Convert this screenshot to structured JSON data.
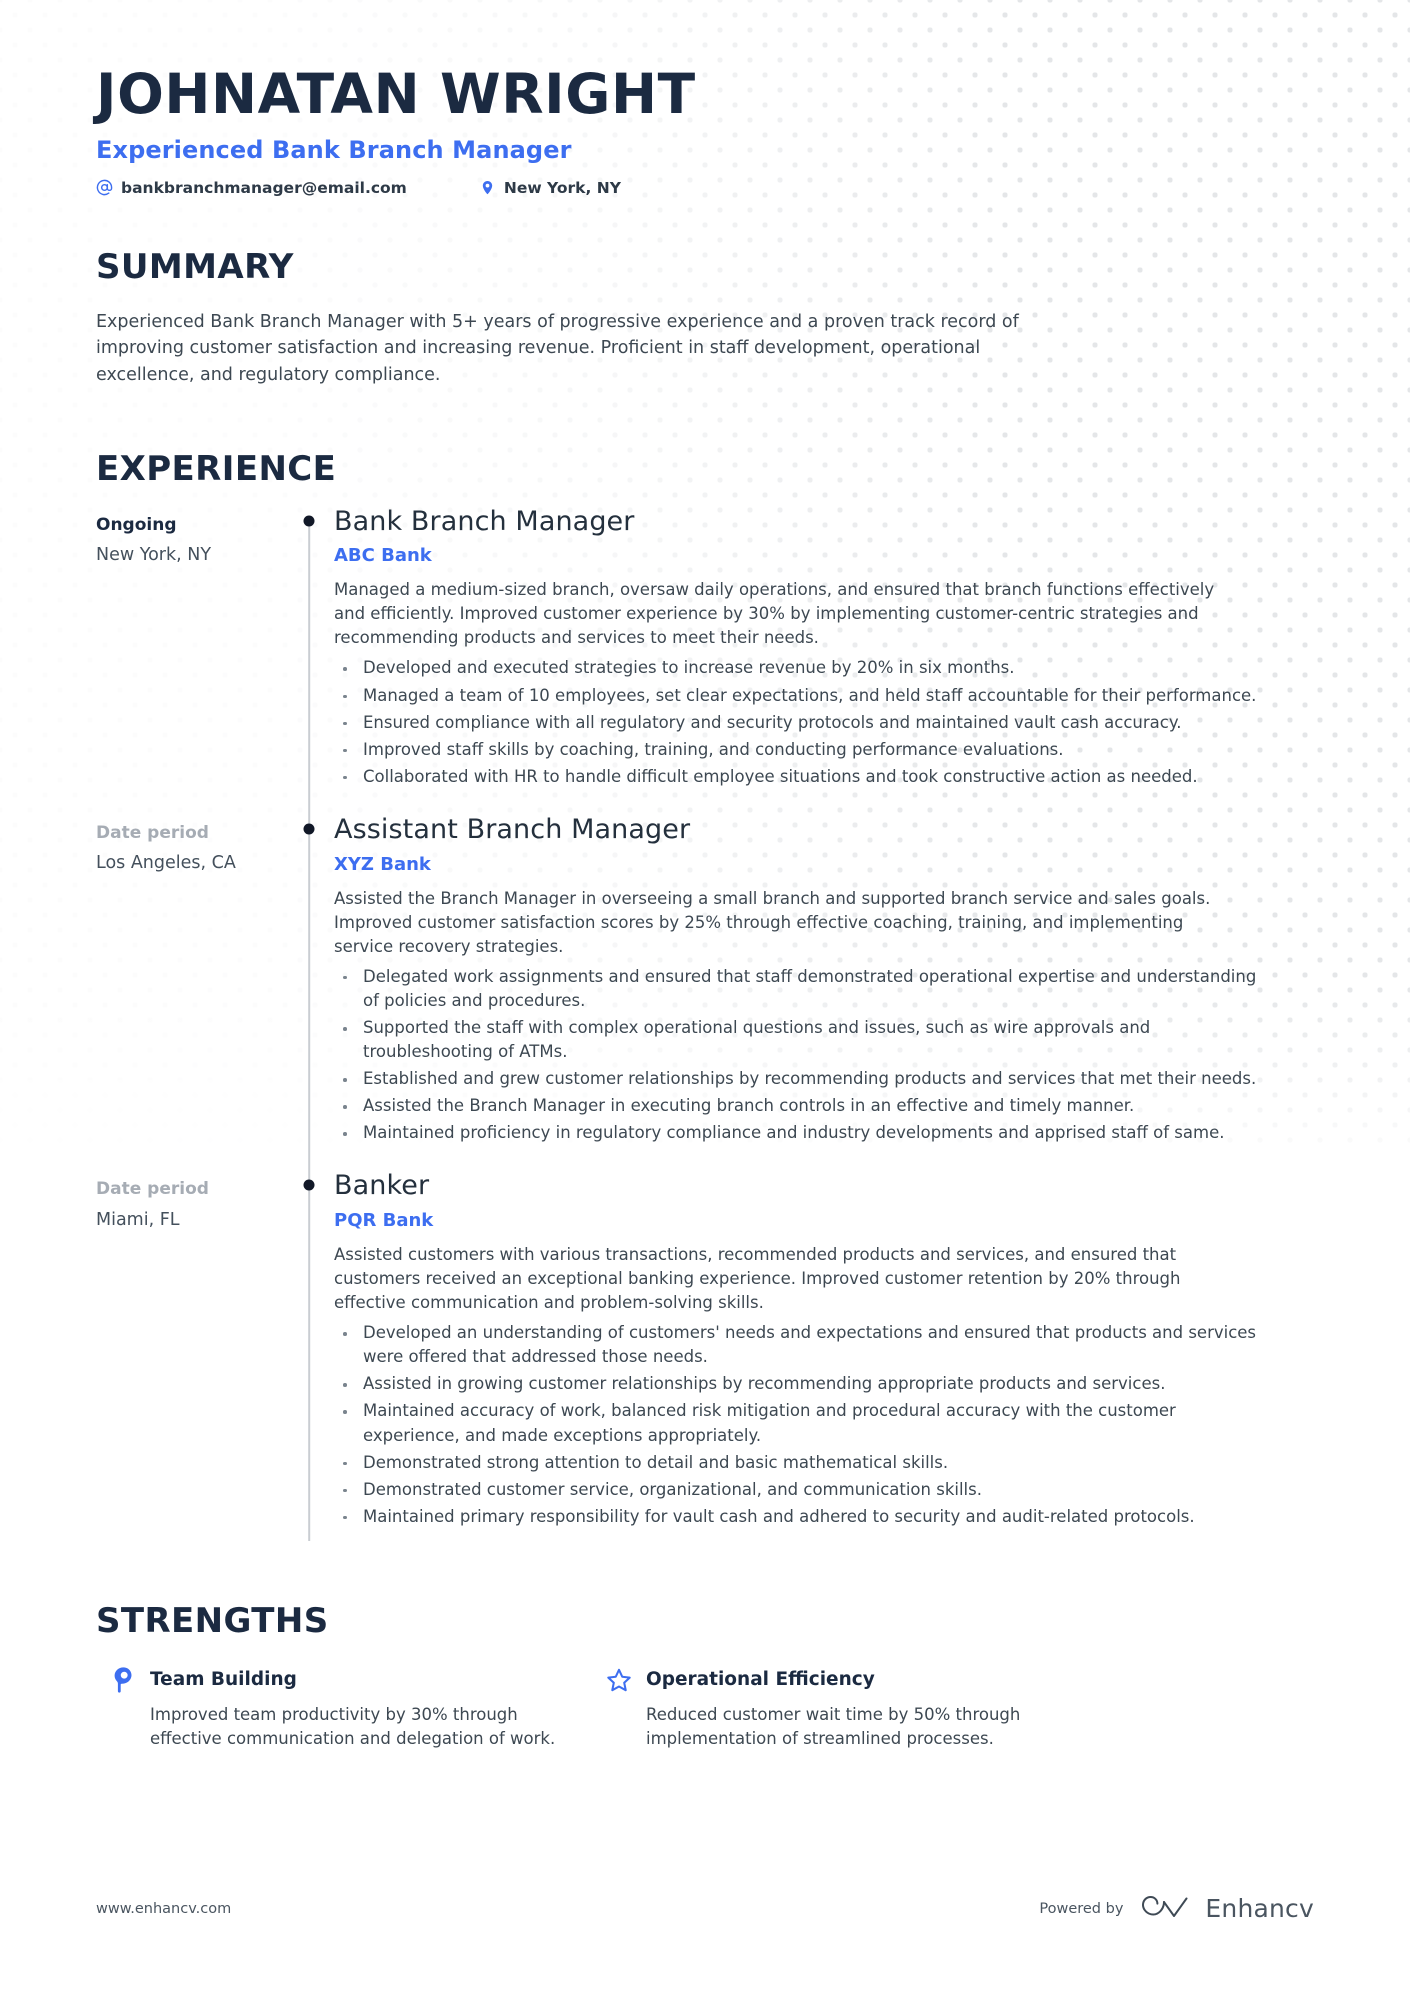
{
  "header": {
    "full_name": "Johnatan Wright",
    "job_title": "Experienced Bank Branch Manager",
    "contacts": [
      {
        "icon": "at-sign-icon",
        "value": "bankbranchmanager@email.com"
      },
      {
        "icon": "location-pin-icon",
        "value": "New York, NY"
      }
    ]
  },
  "summary": {
    "title": "Summary",
    "text": "Experienced Bank Branch Manager with 5+ years of progressive experience and a proven track record of improving customer satisfaction and increasing revenue. Proficient in staff development, operational excellence, and regulatory compliance."
  },
  "experience": {
    "title": "Experience",
    "entries": [
      {
        "date": "Ongoing",
        "date_is_placeholder": false,
        "location": "New York, NY",
        "role": "Bank Branch Manager",
        "company": "ABC Bank",
        "description": "Managed a medium-sized branch, oversaw daily operations, and ensured that branch functions effectively and efficiently. Improved customer experience by 30% by implementing customer-centric strategies and recommending products and services to meet their needs.",
        "bullets": [
          "Developed and executed strategies to increase revenue by 20% in six months.",
          "Managed a team of 10 employees, set clear expectations, and held staff accountable for their performance.",
          "Ensured compliance with all regulatory and security protocols and maintained vault cash accuracy.",
          "Improved staff skills by coaching, training, and conducting performance evaluations.",
          "Collaborated with HR to handle difficult employee situations and took constructive action as needed."
        ]
      },
      {
        "date": "Date period",
        "date_is_placeholder": true,
        "location": "Los Angeles, CA",
        "role": "Assistant Branch Manager",
        "company": "XYZ Bank",
        "description": "Assisted the Branch Manager in overseeing a small branch and supported branch service and sales goals. Improved customer satisfaction scores by 25% through effective coaching, training, and implementing service recovery strategies.",
        "bullets": [
          "Delegated work assignments and ensured that staff demonstrated operational expertise and understanding of policies and procedures.",
          "Supported the staff with complex operational questions and issues, such as wire approvals and troubleshooting of ATMs.",
          "Established and grew customer relationships by recommending products and services that met their needs.",
          "Assisted the Branch Manager in executing branch controls in an effective and timely manner.",
          "Maintained proficiency in regulatory compliance and industry developments and apprised staff of same."
        ]
      },
      {
        "date": "Date period",
        "date_is_placeholder": true,
        "location": "Miami, FL",
        "role": "Banker",
        "company": "PQR Bank",
        "description": "Assisted customers with various transactions, recommended products and services, and ensured that customers received an exceptional banking experience. Improved customer retention by 20% through effective communication and problem-solving skills.",
        "bullets": [
          "Developed an understanding of customers' needs and expectations and ensured that products and services were offered that addressed those needs.",
          "Assisted in growing customer relationships by recommending appropriate products and services.",
          "Maintained accuracy of work, balanced risk mitigation and procedural accuracy with the customer experience, and made exceptions appropriately.",
          "Demonstrated strong attention to detail and basic mathematical skills.",
          "Demonstrated customer service, organizational, and communication skills.",
          "Maintained primary responsibility for vault cash and adhered to security and audit-related protocols."
        ]
      }
    ]
  },
  "strengths": {
    "title": "Strengths",
    "items": [
      {
        "icon": "head-profile-icon",
        "name": "Team Building",
        "description": "Improved team productivity by 30% through effective communication and delegation of work."
      },
      {
        "icon": "star-outline-icon",
        "name": "Operational Efficiency",
        "description": "Reduced customer wait time by 50% through implementation of streamlined processes."
      }
    ]
  },
  "footer": {
    "url": "www.enhancv.com",
    "powered_by": "Powered by",
    "brand_name": "Enhancv"
  },
  "colors": {
    "accent_blue": "#3d6ef0",
    "heading_navy": "#1b2a41",
    "body_gray": "#3d4852",
    "placeholder_gray": "#a6acb4",
    "timeline_line": "#c9cdd2",
    "dot_pattern": "#e4e6e8"
  }
}
